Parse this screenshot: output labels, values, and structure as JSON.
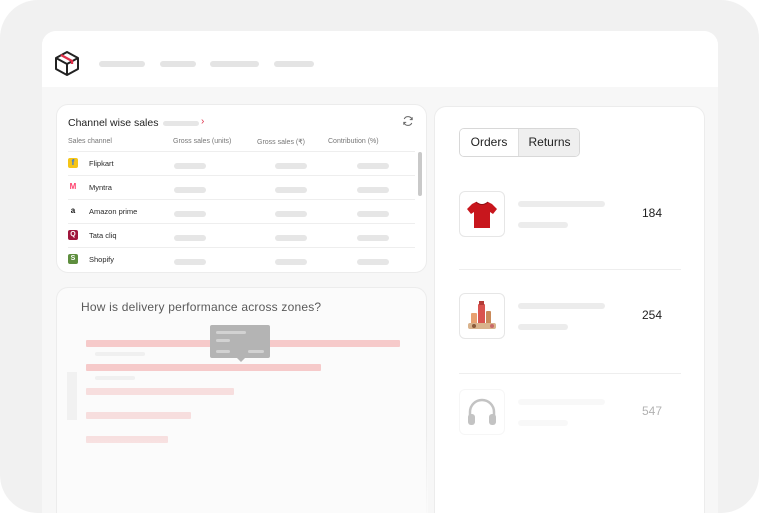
{
  "sales": {
    "title": "Channel wise sales",
    "columns": [
      "Sales channel",
      "Gross sales (units)",
      "Gross sales (₹)",
      "Contribution (%)"
    ],
    "channels": [
      {
        "name": "Flipkart",
        "icon": "flipkart-icon",
        "color": "#f5c518",
        "glyph": "f"
      },
      {
        "name": "Myntra",
        "icon": "myntra-icon",
        "color": "#ff3f6c",
        "glyph": "M"
      },
      {
        "name": "Amazon prime",
        "icon": "amazon-icon",
        "color": "#111111",
        "glyph": "a"
      },
      {
        "name": "Tata cliq",
        "icon": "tata-cliq-icon",
        "color": "#a0173c",
        "glyph": "Q"
      },
      {
        "name": "Shopify",
        "icon": "shopify-icon",
        "color": "#5e8e3e",
        "glyph": "S"
      }
    ]
  },
  "delivery": {
    "question": "How is delivery performance across zones?"
  },
  "orders_panel": {
    "tabs": [
      {
        "label": "Orders",
        "active": false
      },
      {
        "label": "Returns",
        "active": true
      }
    ],
    "products": [
      {
        "icon": "tshirt-icon",
        "count": "184"
      },
      {
        "icon": "cosmetics-icon",
        "count": "254"
      },
      {
        "icon": "headphones-icon",
        "count": "547"
      }
    ]
  },
  "colors": {
    "accent": "#e0304a",
    "bar": "#f6caca"
  }
}
